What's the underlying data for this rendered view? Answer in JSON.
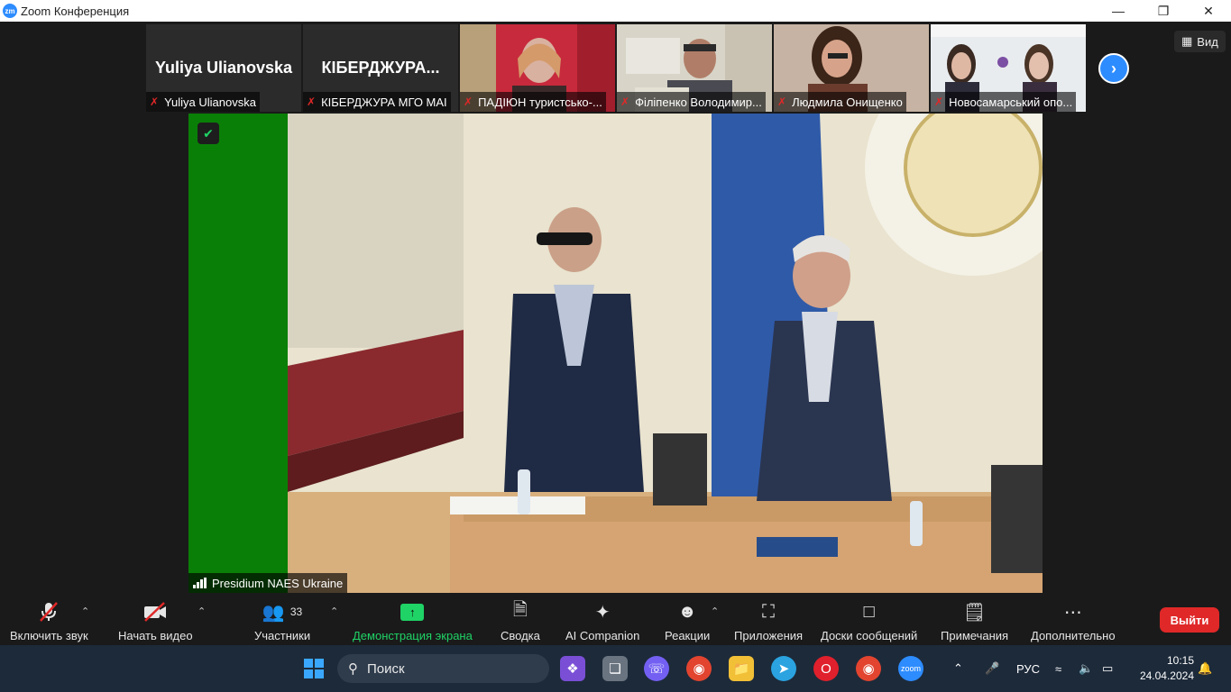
{
  "window": {
    "title": "Zoom Конференция",
    "logo": "zm"
  },
  "view_button": {
    "label": "Вид"
  },
  "participants_strip": [
    {
      "display_name": "Yuliya Ulianovska",
      "label": "Yuliya Ulianovska",
      "has_video": false
    },
    {
      "display_name": "КІБЕРДЖУРА...",
      "label": "КІБЕРДЖУРА МГО МАІ",
      "has_video": false
    },
    {
      "display_name": "",
      "label": "ПАДІЮН туристсько-...",
      "has_video": true
    },
    {
      "display_name": "",
      "label": "Філіпенко Володимир...",
      "has_video": true
    },
    {
      "display_name": "",
      "label": "Людмила Онищенко",
      "has_video": true
    },
    {
      "display_name": "",
      "label": "Новосамарський опо...",
      "has_video": true
    }
  ],
  "main_video": {
    "label": "Presidium NAES Ukraine"
  },
  "toolbar": {
    "unmute": "Включить звук",
    "start_video": "Начать видео",
    "participants": "Участники",
    "participants_count": "33",
    "share_screen": "Демонстрация экрана",
    "summary": "Сводка",
    "ai_companion": "AI Companion",
    "reactions": "Реакции",
    "apps": "Приложения",
    "whiteboards": "Доски сообщений",
    "notes": "Примечания",
    "more": "Дополнительно",
    "leave": "Выйти"
  },
  "taskbar": {
    "search_placeholder": "Поиск",
    "language": "РУС",
    "time": "10:15",
    "date": "24.04.2024"
  },
  "colors": {
    "accent": "#2d8cff",
    "share": "#1fd366",
    "leave": "#e02828",
    "mic_off": "#e02828"
  }
}
